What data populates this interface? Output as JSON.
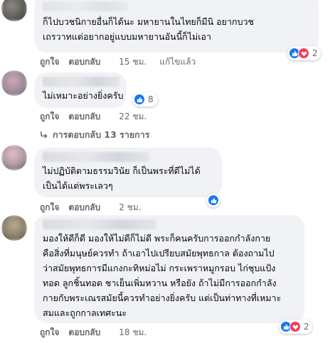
{
  "comments": [
    {
      "text_lines": [
        "ก็ไปบวชนิกายอื่นก็ได้นะ มหายานในไทยก็มีนิ อยากบวช",
        "เถรวาทแต่อยากอยู่แบบมหายานอันนี้ก็ไม่เอา"
      ],
      "reaction_count": "2",
      "like": "ถูกใจ",
      "reply": "ตอบกลับ",
      "time": "15 ชม.",
      "edited": "แก้ไขแล้ว"
    },
    {
      "text_lines": [
        "ไม่เหมาะอย่างยิ่งครับ"
      ],
      "reaction_count": "8",
      "like": "ถูกใจ",
      "reply": "ตอบกลับ",
      "time": "22 ชม.",
      "replies_text": "การตอบกลับ 13 รายการ"
    },
    {
      "text_lines": [
        "ไม่ปฏิบัติตามธรรมวินัย ก็เป็นพระที่ดีไม่ได้",
        "เป็นได้แต่พระเลวๆ"
      ],
      "like": "ถูกใจ",
      "reply": "ตอบกลับ",
      "time": "2 ชม."
    },
    {
      "text_lines": [
        "มองให้ดีก็ดี มองให้ไม่ดีก็ไม่ดี พระก็คนครับการออกกำลังกาย",
        "คือสิ่งที่มนุษย์ควรทำ ถ้าเอาไปเปรียบสมัยพุทธกาล ต้องถามไป",
        "ว่าสมัยพุทธการมีแกงกะทิหม่อไม่ กระเพราหมูกรอบ ไก่ชุบแป้ง",
        "ทอด ลูกชิ้นทอด ชาเย็นเพิ่มหวาน หรือยัง ถ้าไม่มีการออกกำลัง",
        "กายกับพระเณรสมัยนี้ควรทำอย่างยิ่งครับ แต่เป็นท่าทางที่เหมาะ",
        "สมและถูกกาลเทศะนะ"
      ],
      "reaction_count": "2",
      "like": "ถูกใจ",
      "reply": "ตอบกลับ",
      "time": "18 ชม."
    }
  ],
  "colors": {
    "bubble": "#f0f2f5",
    "meta_text": "#65676b",
    "like_blue": "#1877f2",
    "love_red": "#f33e58"
  },
  "icons": [
    "like-icon",
    "love-icon",
    "reply-arrow-icon"
  ]
}
